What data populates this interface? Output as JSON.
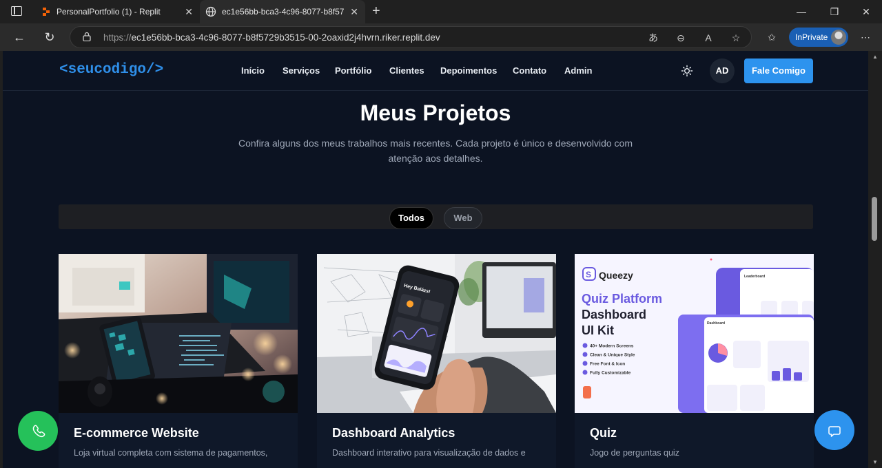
{
  "browser": {
    "tabs": [
      {
        "title": "PersonalPortfolio (1) - Replit",
        "state": "inactive"
      },
      {
        "title": "ec1e56bb-bca3-4c96-8077-b8f57",
        "state": "active"
      }
    ],
    "url_prefix": "https://",
    "url_host": "ec1e56bb-bca3-4c96-8077-b8f5729b3515-00-2oaxid2j4hvrn.riker.replit.dev",
    "inprivate_label": "InPrivate",
    "icons": [
      "tab-actions-icon",
      "replit-icon",
      "globe-icon",
      "close-icon",
      "new-tab-icon",
      "minimize-icon",
      "restore-icon",
      "window-close-icon",
      "back-icon",
      "refresh-icon",
      "lock-icon",
      "translate-icon",
      "zoom-icon",
      "read-aloud-icon",
      "favorite-icon",
      "favorites-icon",
      "more-icon"
    ]
  },
  "site": {
    "logo": "<seucodigo/>",
    "nav": [
      "Início",
      "Serviços",
      "Portfólio",
      "Clientes",
      "Depoimentos",
      "Contato",
      "Admin"
    ],
    "avatar_initials": "AD",
    "cta_label": "Fale Comigo",
    "accent": "#2d93ee",
    "background": "#0c1322"
  },
  "section": {
    "title": "Meus Projetos",
    "subtitle_line1": "Confira alguns dos meus trabalhos mais recentes. Cada projeto é único e desenvolvido com",
    "subtitle_line2": "atenção aos detalhes.",
    "filters": [
      {
        "label": "Todos",
        "active": true
      },
      {
        "label": "Web",
        "active": false
      }
    ]
  },
  "projects": [
    {
      "title": "E-commerce Website",
      "description": "Loja virtual completa com sistema de pagamentos,"
    },
    {
      "title": "Dashboard Analytics",
      "description": "Dashboard interativo para visualização de dados e",
      "phone_greeting": "Hey Balázs!"
    },
    {
      "title": "Quiz",
      "description": "Jogo de perguntas quiz",
      "thumb": {
        "brand": "Queezy",
        "headline1": "Quiz Platform",
        "headline2": "Dashboard",
        "headline3": "UI Kit",
        "features": [
          "40+ Modern Screens",
          "Clean & Unique Style",
          "Free Font & Icon",
          "Fully Customizable"
        ],
        "panel_labels": [
          "Leaderboard",
          "Dashboard"
        ]
      }
    }
  ],
  "fabs": {
    "whatsapp_color": "#25c15a",
    "chat_color": "#2d93ee"
  }
}
